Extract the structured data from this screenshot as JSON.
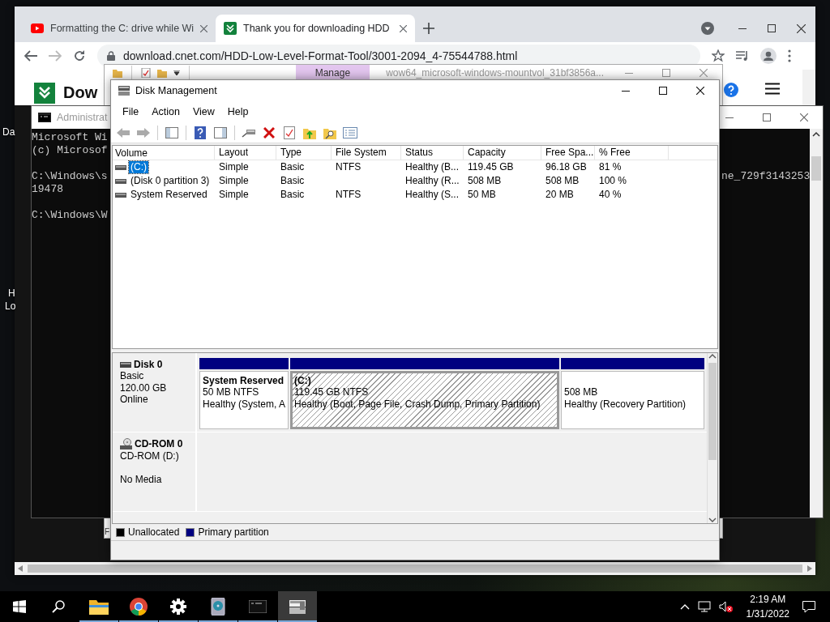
{
  "desktop_icons": [
    {
      "label": "Da"
    },
    {
      "label": "H"
    },
    {
      "label": "Lo"
    }
  ],
  "browser": {
    "tabs": [
      {
        "kind": "video",
        "title": "Formatting the C: drive while Wi",
        "selected": false
      },
      {
        "kind": "download",
        "title": "Thank you for downloading HDD",
        "selected": true
      }
    ],
    "url": "download.cnet.com/HDD-Low-Level-Format-Tool/3001-2094_4-75544788.html",
    "logo_text": "Dow"
  },
  "explorer": {
    "ribbon_tab": "Manage",
    "title": "wow64_microsoft-windows-mountvol_31bf3856a...",
    "status_text": "F"
  },
  "console": {
    "title": "Administrat",
    "line_groups": [
      [
        "Microsoft Wi",
        "(c) Microsof"
      ],
      [
        "C:\\Windows\\s",
        "19478"
      ],
      [
        "C:\\Windows\\W"
      ]
    ],
    "right_text": "ne_729f3143253"
  },
  "disk_management": {
    "title": "Disk Management",
    "menu": [
      "File",
      "Action",
      "View",
      "Help"
    ],
    "columns": [
      "Volume",
      "Layout",
      "Type",
      "File System",
      "Status",
      "Capacity",
      "Free Spa...",
      "% Free"
    ],
    "rows": [
      {
        "selected": true,
        "volume": "(C:)",
        "layout": "Simple",
        "type": "Basic",
        "file_system": "NTFS",
        "status": "Healthy (B...",
        "capacity": "119.45 GB",
        "free_space": "96.18 GB",
        "percent_free": "81 %"
      },
      {
        "selected": false,
        "volume": "(Disk 0 partition 3)",
        "layout": "Simple",
        "type": "Basic",
        "status": "Healthy (R...",
        "capacity": "508 MB",
        "free_space": "508 MB",
        "percent_free": "100 %"
      },
      {
        "selected": false,
        "volume": "System Reserved",
        "layout": "Simple",
        "type": "Basic",
        "file_system": "NTFS",
        "status": "Healthy (S...",
        "capacity": "50 MB",
        "free_space": "20 MB",
        "percent_free": "40 %"
      }
    ],
    "disks": [
      {
        "kind": "disk",
        "name": "Disk 0",
        "detail_groups": [
          [
            "Basic",
            "120.00 GB",
            "Online"
          ]
        ],
        "partitions": [
          {
            "name": "System Reserved",
            "size": "50 MB NTFS",
            "status": "Healthy (System, A",
            "selected": false
          },
          {
            "name": "(C:)",
            "size": "119.45 GB NTFS",
            "status": "Healthy (Boot, Page File, Crash Dump, Primary Partition)",
            "selected": true
          },
          {
            "size": "508 MB",
            "status": "Healthy (Recovery Partition)",
            "selected": false
          }
        ]
      },
      {
        "kind": "cdrom",
        "name": "CD-ROM 0",
        "detail_groups": [
          [
            "CD-ROM (D:)"
          ],
          [
            "No Media"
          ]
        ]
      }
    ],
    "legend": [
      {
        "label": "Unallocated",
        "color": "#000000"
      },
      {
        "label": "Primary partition",
        "color": "#000080"
      }
    ]
  },
  "taskbar": {
    "apps": [
      {
        "kind": "folder",
        "selected": false
      },
      {
        "kind": "browser",
        "selected": false
      },
      {
        "kind": "gear",
        "selected": false
      },
      {
        "kind": "disk-app",
        "selected": false
      },
      {
        "kind": "console",
        "selected": false
      },
      {
        "kind": "disk-management",
        "selected": true
      }
    ],
    "time": "2:19 AM",
    "date": "1/31/2022"
  }
}
